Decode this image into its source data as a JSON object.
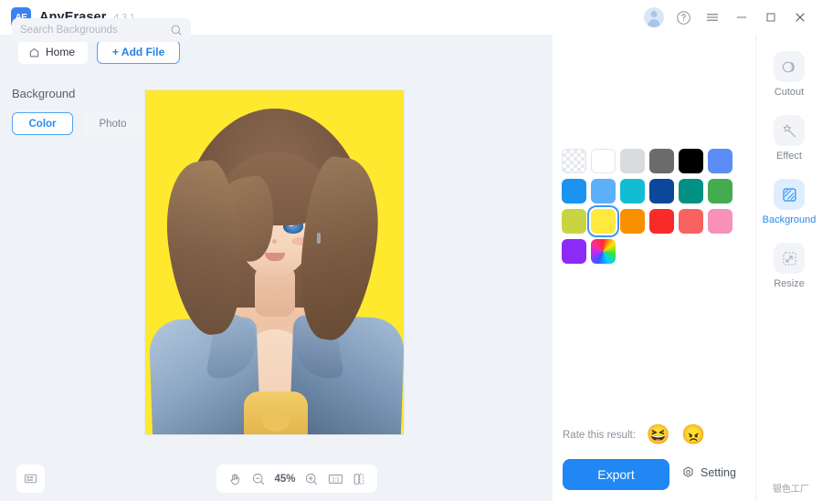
{
  "app": {
    "name": "AnyEraser",
    "version": "4.3.1",
    "logo_text": "AE",
    "accent_color": "#2087f5"
  },
  "titlebar": {
    "account_icon": "account-avatar-icon",
    "help_icon": "help-circle-icon",
    "menu_icon": "hamburger-menu-icon",
    "minimize_icon": "minimize-icon",
    "maximize_icon": "maximize-icon",
    "close_icon": "close-icon"
  },
  "tabbar": {
    "home_label": "Home",
    "home_icon": "home-icon",
    "add_file_label": "+ Add File"
  },
  "canvas": {
    "background_color": "#eff2f7",
    "image_background_color": "#ffe92e",
    "panel_toggle_icon": "panel-layout-icon"
  },
  "zoombar": {
    "hand_icon": "hand-tool-icon",
    "zoom_out_icon": "zoom-out-icon",
    "zoom_level": "45%",
    "zoom_in_icon": "zoom-in-icon",
    "actual_size_label": "1:1",
    "compare_icon": "compare-split-icon"
  },
  "right_panel": {
    "search": {
      "placeholder": "Search Backgrounds",
      "value": "",
      "icon": "search-icon"
    },
    "section_title": "Background",
    "tabs": [
      {
        "label": "Color",
        "active": true
      },
      {
        "label": "Photo",
        "active": false
      }
    ],
    "swatches": [
      {
        "name": "transparent",
        "color": "transparent",
        "style": "checker",
        "selected": false
      },
      {
        "name": "white",
        "color": "#ffffff",
        "style": "bordered",
        "selected": false
      },
      {
        "name": "light-gray",
        "color": "#d9dcdf",
        "style": "plain",
        "selected": false
      },
      {
        "name": "dark-gray",
        "color": "#6b6b6b",
        "style": "plain",
        "selected": false
      },
      {
        "name": "black",
        "color": "#000000",
        "style": "plain",
        "selected": false
      },
      {
        "name": "blue-violet",
        "color": "#5b8cf8",
        "style": "plain",
        "selected": false
      },
      {
        "name": "blue",
        "color": "#1a94f0",
        "style": "plain",
        "selected": false
      },
      {
        "name": "light-blue",
        "color": "#5cb0f7",
        "style": "plain",
        "selected": false
      },
      {
        "name": "cyan",
        "color": "#12bdd4",
        "style": "plain",
        "selected": false
      },
      {
        "name": "navy",
        "color": "#0b479b",
        "style": "plain",
        "selected": false
      },
      {
        "name": "teal",
        "color": "#029185",
        "style": "plain",
        "selected": false
      },
      {
        "name": "green",
        "color": "#45ab50",
        "style": "plain",
        "selected": false
      },
      {
        "name": "yellow-green",
        "color": "#c8d441",
        "style": "plain",
        "selected": false
      },
      {
        "name": "yellow",
        "color": "#ffe93f",
        "style": "plain",
        "selected": true
      },
      {
        "name": "orange",
        "color": "#f99000",
        "style": "plain",
        "selected": false
      },
      {
        "name": "red",
        "color": "#f82a2a",
        "style": "plain",
        "selected": false
      },
      {
        "name": "coral",
        "color": "#f9635f",
        "style": "plain",
        "selected": false
      },
      {
        "name": "pink",
        "color": "#f791b8",
        "style": "plain",
        "selected": false
      },
      {
        "name": "purple",
        "color": "#8c2bf5",
        "style": "plain",
        "selected": false
      },
      {
        "name": "rainbow",
        "color": "rainbow",
        "style": "rainbow",
        "selected": false
      }
    ],
    "rate": {
      "label": "Rate this result:",
      "positive_emoji": "😆",
      "negative_emoji": "😠"
    },
    "export_label": "Export",
    "setting_label": "Setting",
    "setting_icon": "gear-icon"
  },
  "rail": {
    "items": [
      {
        "label": "Cutout",
        "icon": "cutout-circles-icon",
        "active": false
      },
      {
        "label": "Effect",
        "icon": "magic-wand-icon",
        "active": false
      },
      {
        "label": "Background",
        "icon": "background-square-icon",
        "active": true
      },
      {
        "label": "Resize",
        "icon": "resize-arrow-icon",
        "active": false
      }
    ]
  },
  "watermark": {
    "text": "银色工厂"
  }
}
